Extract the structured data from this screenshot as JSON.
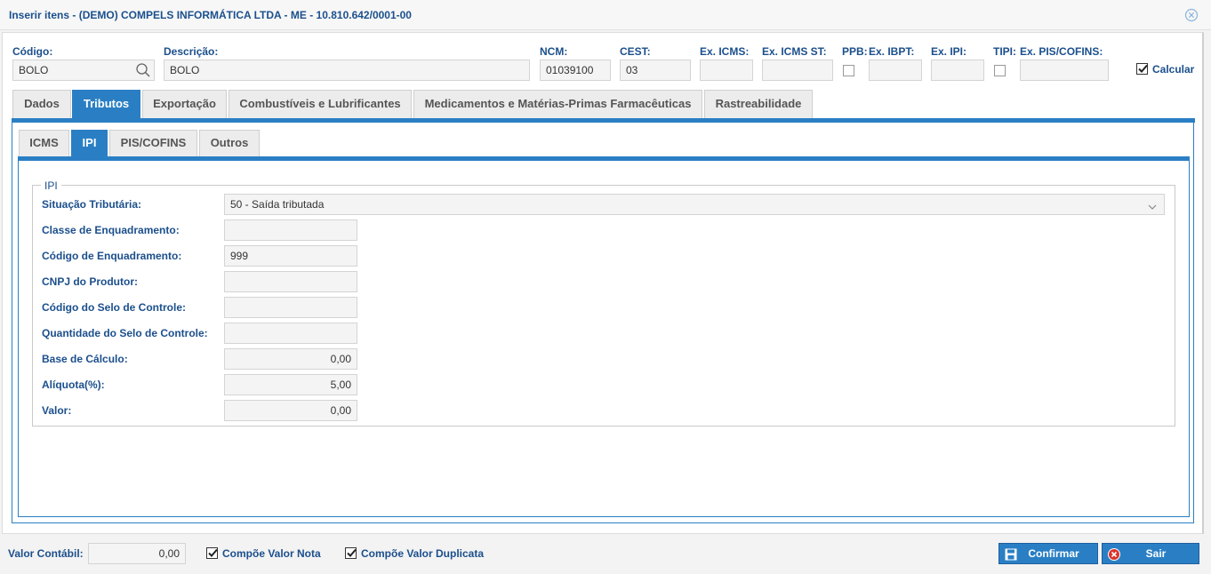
{
  "window": {
    "title": "Inserir itens - (DEMO) COMPELS INFORMÁTICA LTDA - ME - 10.810.642/0001-00"
  },
  "header": {
    "codigo": {
      "label": "Código:",
      "value": "BOLO"
    },
    "descricao": {
      "label": "Descrição:",
      "value": "BOLO"
    },
    "ncm": {
      "label": "NCM:",
      "value": "01039100"
    },
    "cest": {
      "label": "CEST:",
      "value": "03"
    },
    "ex_icms": {
      "label": "Ex. ICMS:",
      "value": ""
    },
    "ex_icms_st": {
      "label": "Ex. ICMS ST:",
      "value": ""
    },
    "ppb": {
      "label": "PPB:",
      "checked": false
    },
    "ex_ibpt": {
      "label": "Ex. IBPT:",
      "value": ""
    },
    "ex_ipi": {
      "label": "Ex. IPI:",
      "value": ""
    },
    "tipi": {
      "label": "TIPI:",
      "checked": false
    },
    "ex_pis_cofins": {
      "label": "Ex. PIS/COFINS:",
      "value": ""
    },
    "calcular": {
      "label": "Calcular",
      "checked": true
    }
  },
  "tabs": [
    {
      "label": "Dados",
      "active": false
    },
    {
      "label": "Tributos",
      "active": true
    },
    {
      "label": "Exportação",
      "active": false
    },
    {
      "label": "Combustíveis e Lubrificantes",
      "active": false
    },
    {
      "label": "Medicamentos e Matérias-Primas Farmacêuticas",
      "active": false
    },
    {
      "label": "Rastreabilidade",
      "active": false
    }
  ],
  "subtabs": [
    {
      "label": "ICMS",
      "active": false
    },
    {
      "label": "IPI",
      "active": true
    },
    {
      "label": "PIS/COFINS",
      "active": false
    },
    {
      "label": "Outros",
      "active": false
    }
  ],
  "ipi": {
    "legend": "IPI",
    "situacao": {
      "label": "Situação Tributária:",
      "value": "50 - Saída tributada"
    },
    "classe": {
      "label": "Classe de Enquadramento:",
      "value": ""
    },
    "codigo_enq": {
      "label": "Código de Enquadramento:",
      "value": "999"
    },
    "cnpj_produtor": {
      "label": "CNPJ do Produtor:",
      "value": ""
    },
    "codigo_selo": {
      "label": "Código do Selo de Controle:",
      "value": ""
    },
    "quantidade_selo": {
      "label": "Quantidade do Selo de Controle:",
      "value": ""
    },
    "base_calculo": {
      "label": "Base de Cálculo:",
      "value": "0,00"
    },
    "aliquota": {
      "label": "Alíquota(%):",
      "value": "5,00"
    },
    "valor": {
      "label": "Valor:",
      "value": "0,00"
    }
  },
  "footer": {
    "valor_contabil": {
      "label": "Valor Contábil:",
      "value": "0,00"
    },
    "compoe_nota": {
      "label": "Compõe Valor Nota",
      "checked": true
    },
    "compoe_duplicata": {
      "label": "Compõe Valor Duplicata",
      "checked": true
    },
    "confirmar": "Confirmar",
    "sair": "Sair"
  },
  "colors": {
    "accent": "#2a7fc4",
    "label": "#1b4f8c",
    "danger": "#d9342b"
  }
}
